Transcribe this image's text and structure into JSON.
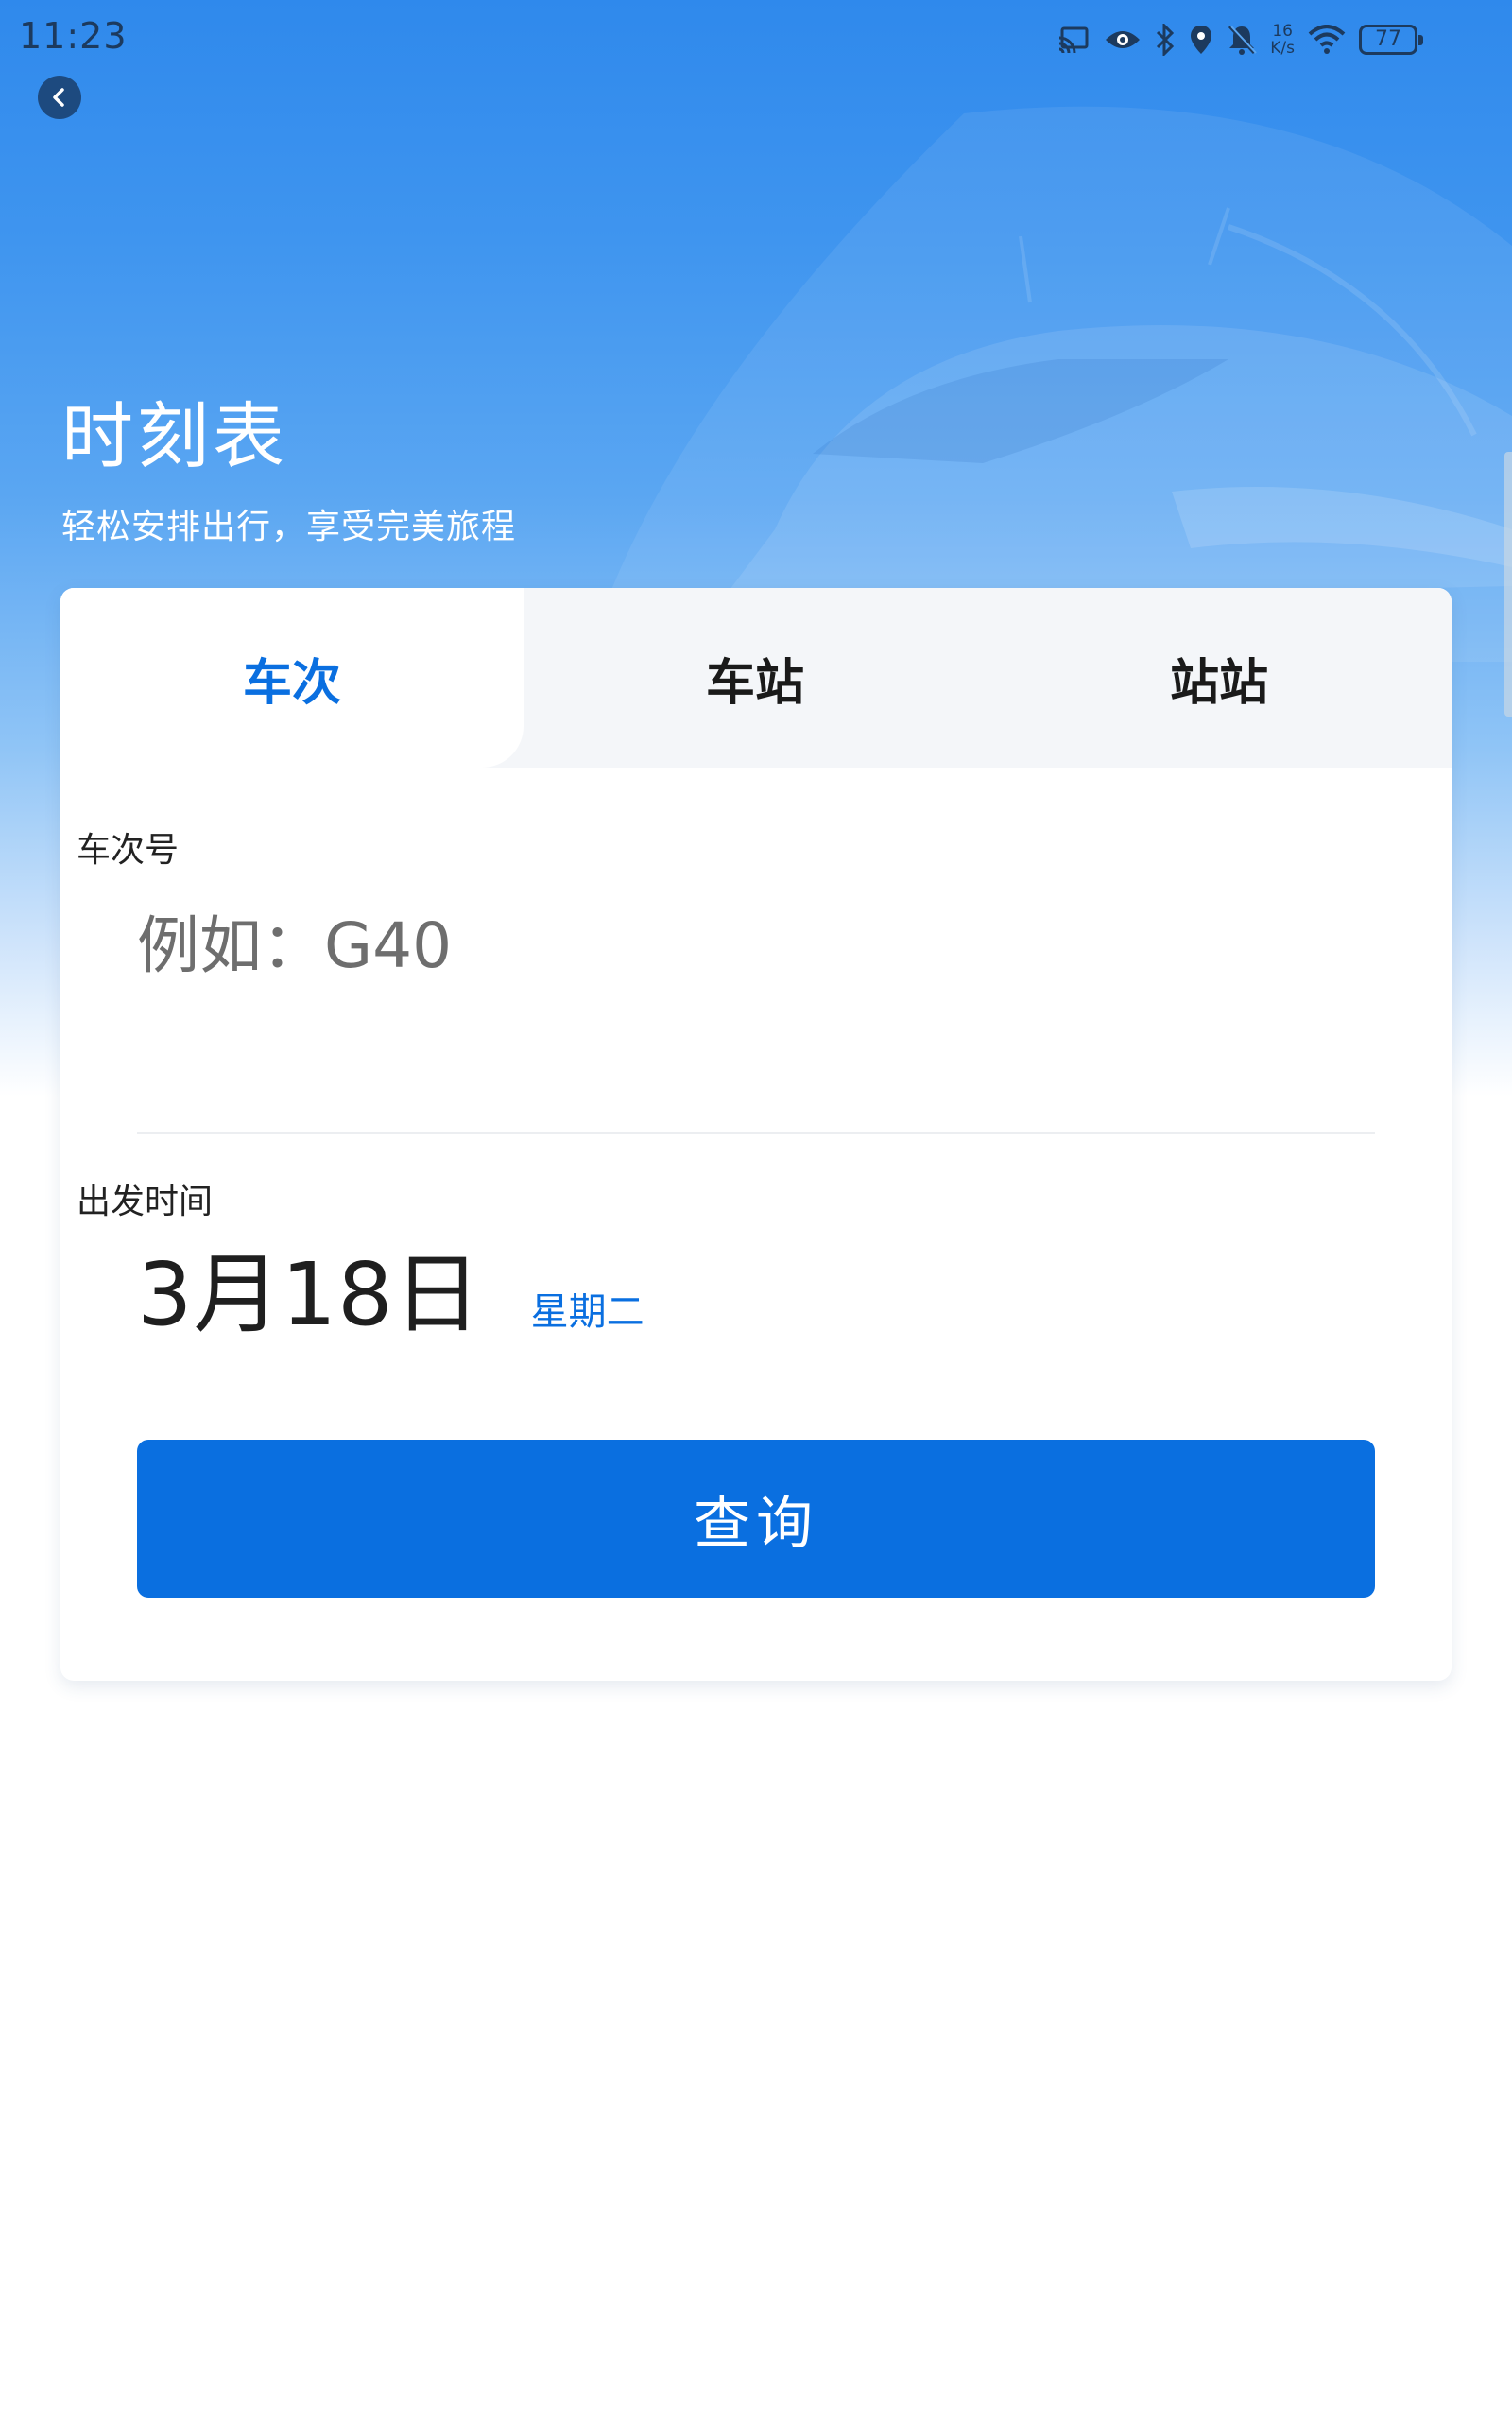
{
  "status_bar": {
    "time": "11:23",
    "net_speed_value": "16",
    "net_speed_unit": "K/s",
    "battery": "77",
    "icons": [
      "cast-icon",
      "eye-icon",
      "bluetooth-icon",
      "location-icon",
      "bell-off-icon",
      "wifi-icon",
      "battery-icon"
    ]
  },
  "header": {
    "title": "时刻表",
    "subtitle": "轻松安排出行，享受完美旅程",
    "back_icon": "chevron-left-icon"
  },
  "tabs": [
    {
      "label": "车次",
      "active": true
    },
    {
      "label": "车站",
      "active": false
    },
    {
      "label": "站站",
      "active": false
    }
  ],
  "form": {
    "train_label": "车次号",
    "train_placeholder": "例如：G40",
    "train_value": "",
    "date_label": "出发时间",
    "date_value": "3月18日",
    "weekday": "星期二",
    "query_button": "查询"
  },
  "colors": {
    "accent": "#0a6fe0",
    "hero_top": "#2f89ec",
    "text_primary": "#1f1f1f"
  }
}
